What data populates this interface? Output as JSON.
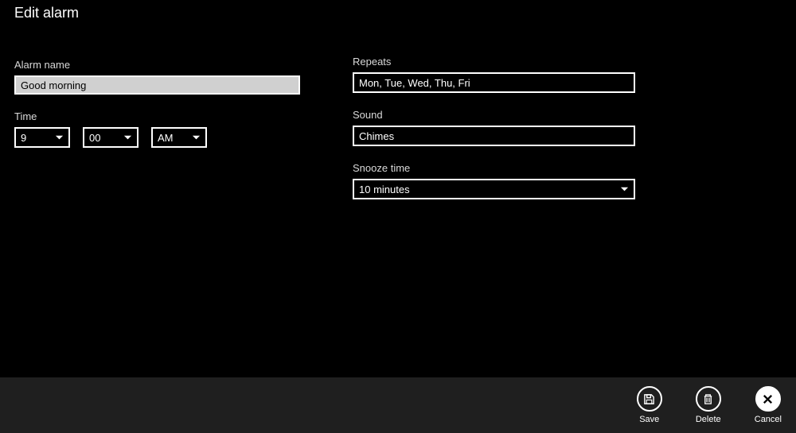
{
  "title": "Edit alarm",
  "left": {
    "name_label": "Alarm name",
    "name_value": "Good morning",
    "time_label": "Time",
    "hour": "9",
    "minute": "00",
    "ampm": "AM"
  },
  "right": {
    "repeats_label": "Repeats",
    "repeats_value": "Mon, Tue, Wed, Thu, Fri",
    "sound_label": "Sound",
    "sound_value": "Chimes",
    "snooze_label": "Snooze time",
    "snooze_value": "10 minutes"
  },
  "footer": {
    "save": "Save",
    "delete": "Delete",
    "cancel": "Cancel"
  }
}
